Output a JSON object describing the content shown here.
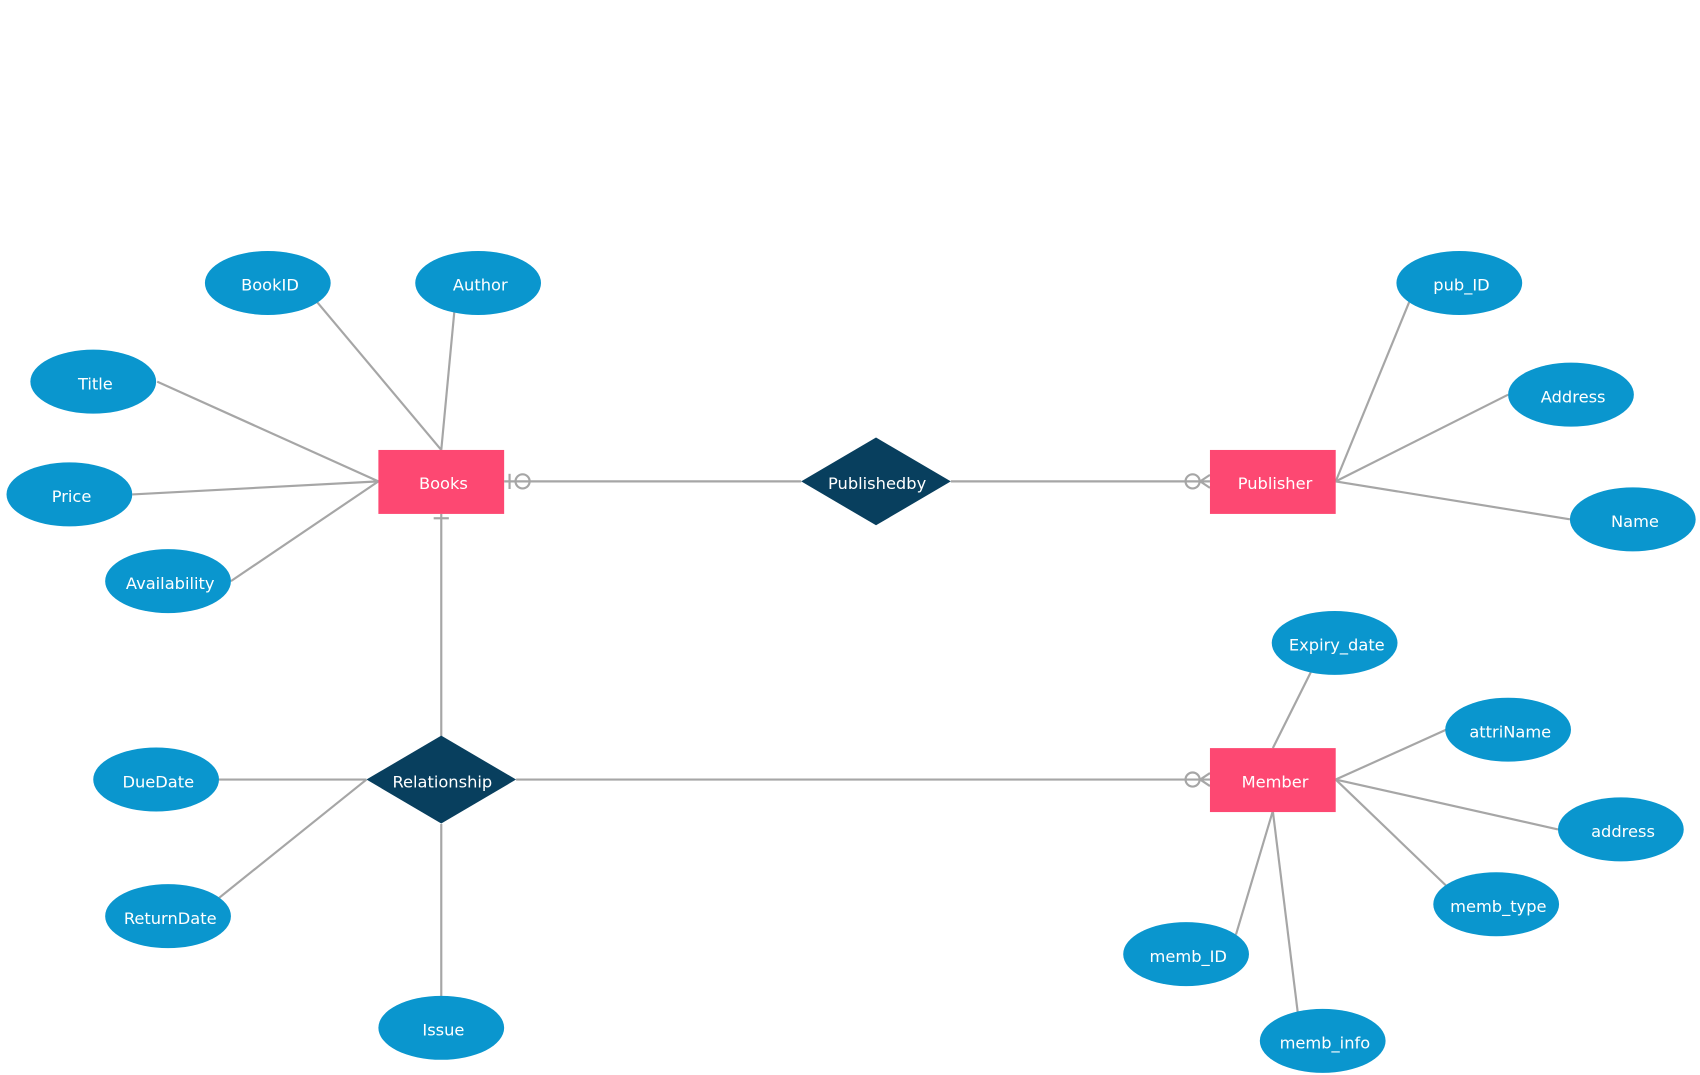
{
  "colors": {
    "entity": "#fd4872",
    "attribute": "#0a96ce",
    "relationship": "#083f5e",
    "line": "#a6a6a6",
    "text": "#ffffff"
  },
  "entities": [
    {
      "id": "books",
      "label": "Books"
    },
    {
      "id": "publisher",
      "label": "Publisher"
    },
    {
      "id": "member",
      "label": "Member"
    }
  ],
  "relationships": [
    {
      "id": "publishedby",
      "label": "Publishedby"
    },
    {
      "id": "relationship",
      "label": "Relationship"
    }
  ],
  "attributes": [
    {
      "id": "bookid",
      "label": "BookID",
      "of": "books"
    },
    {
      "id": "author",
      "label": "Author",
      "of": "books"
    },
    {
      "id": "title",
      "label": "Title",
      "of": "books"
    },
    {
      "id": "price",
      "label": "Price",
      "of": "books"
    },
    {
      "id": "availability",
      "label": "Availability",
      "of": "books"
    },
    {
      "id": "pub_id",
      "label": "pub_ID",
      "of": "publisher"
    },
    {
      "id": "address-pub",
      "label": "Address",
      "of": "publisher"
    },
    {
      "id": "name",
      "label": "Name",
      "of": "publisher"
    },
    {
      "id": "expiry_date",
      "label": "Expiry_date",
      "of": "member"
    },
    {
      "id": "attriname",
      "label": "attriName",
      "of": "member"
    },
    {
      "id": "address-mem",
      "label": "address",
      "of": "member"
    },
    {
      "id": "memb_type",
      "label": "memb_type",
      "of": "member"
    },
    {
      "id": "memb_id",
      "label": "memb_ID",
      "of": "member"
    },
    {
      "id": "memb_info",
      "label": "memb_info",
      "of": "member"
    },
    {
      "id": "duedate",
      "label": "DueDate",
      "of": "relationship"
    },
    {
      "id": "returndate",
      "label": "ReturnDate",
      "of": "relationship"
    },
    {
      "id": "issue",
      "label": "Issue",
      "of": "relationship"
    }
  ],
  "links": [
    {
      "from": "books",
      "to": "publishedby",
      "from_cardinality": "zero-or-one"
    },
    {
      "from": "publishedby",
      "to": "publisher",
      "to_cardinality": "zero-or-many"
    },
    {
      "from": "books",
      "to": "relationship",
      "from_cardinality": "one"
    },
    {
      "from": "relationship",
      "to": "member",
      "to_cardinality": "zero-or-many"
    }
  ]
}
